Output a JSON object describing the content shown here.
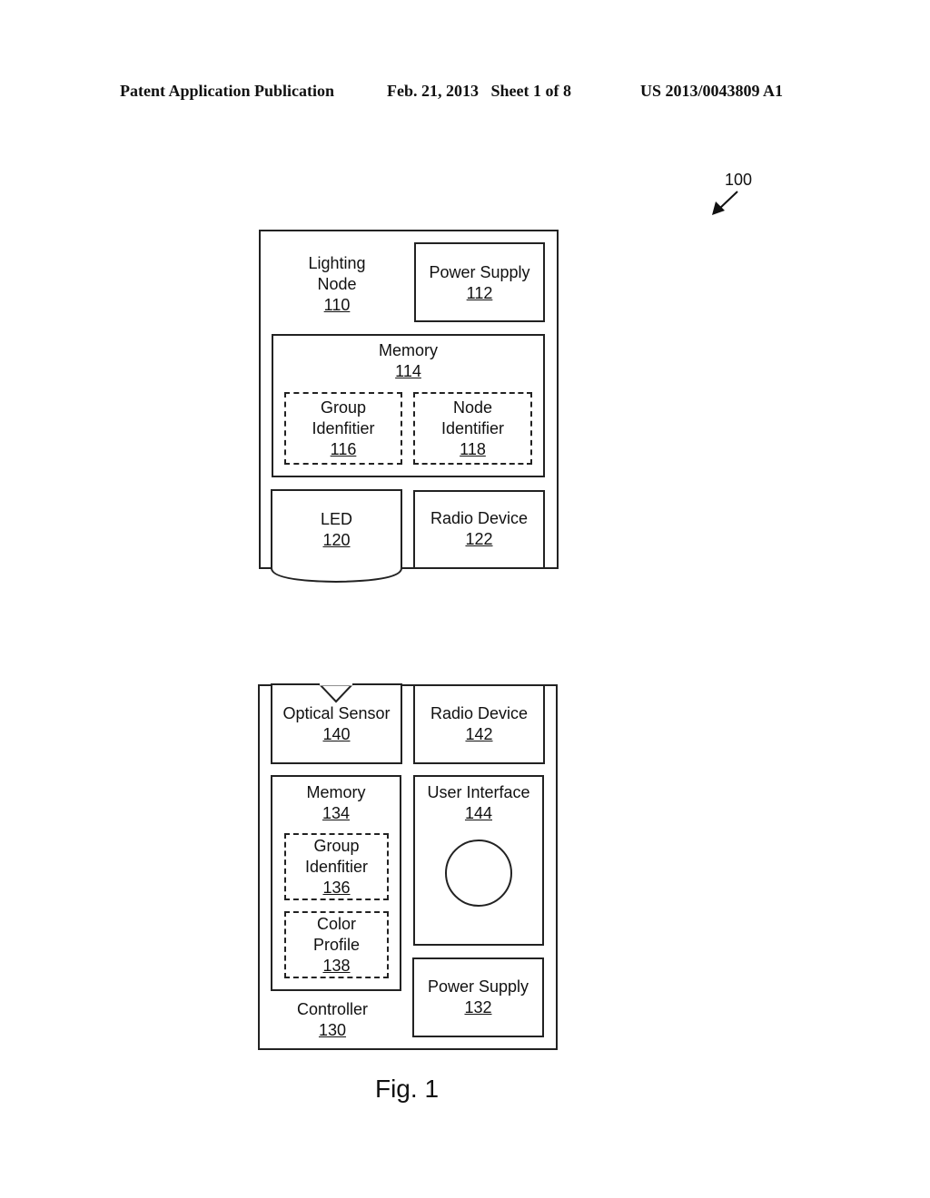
{
  "header": {
    "publication": "Patent Application Publication",
    "date_sheet": "Feb. 21, 2013   Sheet 1 of 8",
    "number": "US 2013/0043809 A1"
  },
  "ref_100": "100",
  "lighting_node": {
    "title_lines": [
      "Lighting",
      "Node"
    ],
    "num": "110",
    "power_supply": {
      "title": "Power Supply",
      "num": "112"
    },
    "memory": {
      "title": "Memory",
      "num": "114",
      "group_identifier": {
        "lines": [
          "Group",
          "Idenfitier"
        ],
        "num": "116"
      },
      "node_identifier": {
        "lines": [
          "Node",
          "Identifier"
        ],
        "num": "118"
      }
    },
    "led": {
      "title": "LED",
      "num": "120"
    },
    "radio_device": {
      "title": "Radio Device",
      "num": "122"
    }
  },
  "controller": {
    "title": "Controller",
    "num": "130",
    "optical_sensor": {
      "title": "Optical Sensor",
      "num": "140"
    },
    "radio_device": {
      "title": "Radio Device",
      "num": "142"
    },
    "memory": {
      "title": "Memory",
      "num": "134",
      "group_identifier": {
        "lines": [
          "Group",
          "Idenfitier"
        ],
        "num": "136"
      },
      "color_profile": {
        "lines": [
          "Color",
          "Profile"
        ],
        "num": "138"
      }
    },
    "user_interface": {
      "title": "User Interface",
      "num": "144"
    },
    "power_supply": {
      "title": "Power Supply",
      "num": "132"
    }
  },
  "figure_caption": "Fig. 1"
}
